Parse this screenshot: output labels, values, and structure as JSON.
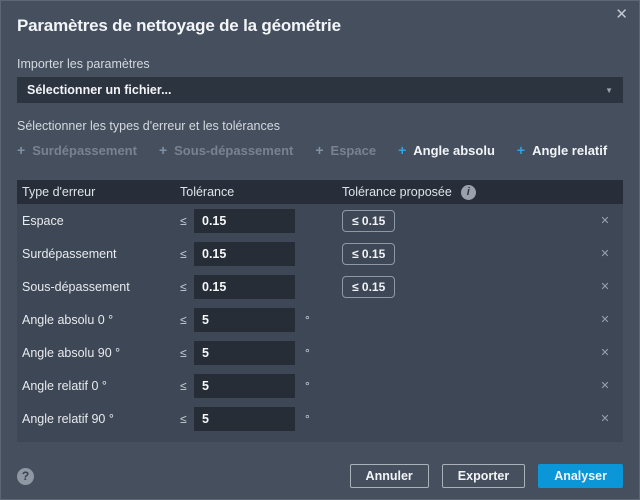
{
  "dialog": {
    "title": "Paramètres de nettoyage de la géométrie",
    "close_icon": "✕"
  },
  "import_section": {
    "label": "Importer les paramètres",
    "file_select_value": "Sélectionner un fichier..."
  },
  "error_types": {
    "label": "Sélectionner les types d'erreur et les tolérances",
    "toggles": [
      {
        "prefix": "+",
        "label": "Surdépassement",
        "enabled": false
      },
      {
        "prefix": "+",
        "label": "Sous-dépassement",
        "enabled": false
      },
      {
        "prefix": "+",
        "label": "Espace",
        "enabled": false
      },
      {
        "prefix": "+",
        "label": "Angle absolu",
        "enabled": true
      },
      {
        "prefix": "+",
        "label": "Angle relatif",
        "enabled": true
      }
    ]
  },
  "table": {
    "col_type": "Type d'erreur",
    "col_tolerance": "Tolérance",
    "col_proposed": "Tolérance proposée",
    "info_icon": "i",
    "remove_icon": "✕",
    "rows": [
      {
        "type": "Espace",
        "operator": "≤",
        "tolerance": "0.15",
        "unit": "",
        "proposed": "≤ 0.15"
      },
      {
        "type": "Surdépassement",
        "operator": "≤",
        "tolerance": "0.15",
        "unit": "",
        "proposed": "≤ 0.15"
      },
      {
        "type": "Sous-dépassement",
        "operator": "≤",
        "tolerance": "0.15",
        "unit": "",
        "proposed": "≤ 0.15"
      },
      {
        "type": "Angle absolu 0 °",
        "operator": "≤",
        "tolerance": "5",
        "unit": "°",
        "proposed": ""
      },
      {
        "type": "Angle absolu 90 °",
        "operator": "≤",
        "tolerance": "5",
        "unit": "°",
        "proposed": ""
      },
      {
        "type": "Angle relatif 0 °",
        "operator": "≤",
        "tolerance": "5",
        "unit": "°",
        "proposed": ""
      },
      {
        "type": "Angle relatif 90 °",
        "operator": "≤",
        "tolerance": "5",
        "unit": "°",
        "proposed": ""
      }
    ]
  },
  "footer": {
    "help_icon": "?",
    "cancel_label": "Annuler",
    "export_label": "Exporter",
    "analyze_label": "Analyser"
  },
  "colors": {
    "dialog_background": "#454f5e",
    "field_background": "#262d37",
    "accent_blue": "#2ea3e5",
    "analyze_button": "#0a96d7"
  }
}
